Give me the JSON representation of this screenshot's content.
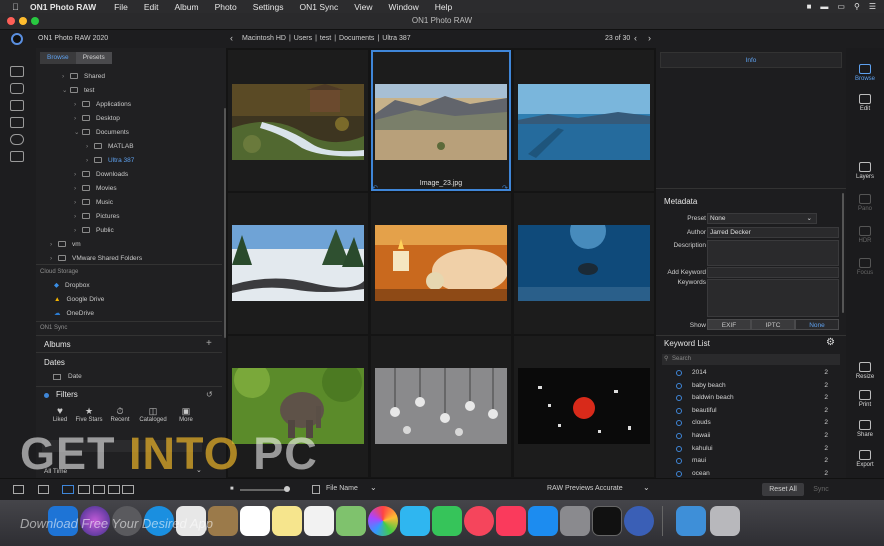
{
  "menubar": {
    "app_name": "ON1 Photo RAW",
    "items": [
      "File",
      "Edit",
      "Album",
      "Photo",
      "Settings",
      "ON1 Sync",
      "View",
      "Window",
      "Help"
    ]
  },
  "window": {
    "title": "ON1 Photo RAW"
  },
  "toolbar": {
    "app_label": "ON1 Photo RAW 2020",
    "breadcrumb": [
      "Macintosh HD",
      "Users",
      "test",
      "Documents",
      "Ultra 387"
    ],
    "position": "23 of 30"
  },
  "left_panel": {
    "tabs": [
      "Browse",
      "Presets"
    ],
    "tree": [
      {
        "label": "Shared",
        "indent": 1,
        "expanded": false
      },
      {
        "label": "test",
        "indent": 1,
        "expanded": true
      },
      {
        "label": "Applications",
        "indent": 2,
        "expanded": false
      },
      {
        "label": "Desktop",
        "indent": 2,
        "expanded": false
      },
      {
        "label": "Documents",
        "indent": 2,
        "expanded": true
      },
      {
        "label": "MATLAB",
        "indent": 3,
        "expanded": false
      },
      {
        "label": "Ultra 387",
        "indent": 3,
        "expanded": false,
        "selected": true
      },
      {
        "label": "Downloads",
        "indent": 2,
        "expanded": false
      },
      {
        "label": "Movies",
        "indent": 2,
        "expanded": false
      },
      {
        "label": "Music",
        "indent": 2,
        "expanded": false
      },
      {
        "label": "Pictures",
        "indent": 2,
        "expanded": false
      },
      {
        "label": "Public",
        "indent": 2,
        "expanded": false
      },
      {
        "label": "vm",
        "indent": 0,
        "expanded": false
      },
      {
        "label": "VMware Shared Folders",
        "indent": 0,
        "expanded": false
      }
    ],
    "cloud_storage_label": "Cloud Storage",
    "cloud": [
      "Dropbox",
      "Google Drive",
      "OneDrive"
    ],
    "sync_label": "ON1 Sync",
    "albums_label": "Albums",
    "dates_label": "Dates",
    "date_item": "Date",
    "filters_label": "Filters",
    "filter_items": [
      "Liked",
      "Five Stars",
      "Recent",
      "Cataloged",
      "More"
    ],
    "time_select": "All Time"
  },
  "grid": {
    "selected_filename": "Image_23.jpg"
  },
  "right_panel": {
    "info_tab": "Info",
    "metadata": {
      "title": "Metadata",
      "preset_label": "Preset",
      "preset_value": "None",
      "author_label": "Author",
      "author_value": "Jarred Decker",
      "description_label": "Description",
      "add_keyword_label": "Add Keyword",
      "keywords_label": "Keywords",
      "show_label": "Show",
      "show_options": [
        "EXIF",
        "IPTC",
        "None"
      ],
      "show_selected": "None"
    },
    "keyword_list": {
      "title": "Keyword List",
      "search_placeholder": "Search",
      "items": [
        {
          "name": "2014",
          "count": "2"
        },
        {
          "name": "baby beach",
          "count": "2"
        },
        {
          "name": "baldwin beach",
          "count": "2"
        },
        {
          "name": "beautiful",
          "count": "2"
        },
        {
          "name": "clouds",
          "count": "2"
        },
        {
          "name": "hawaii",
          "count": "2"
        },
        {
          "name": "kahului",
          "count": "2"
        },
        {
          "name": "maui",
          "count": "2"
        },
        {
          "name": "ocean",
          "count": "2"
        }
      ]
    }
  },
  "right_strip": {
    "items": [
      "Browse",
      "Edit",
      "Layers",
      "Pano",
      "HDR",
      "Focus",
      "Resize",
      "Print",
      "Share",
      "Export"
    ]
  },
  "bottombar": {
    "sort_label": "File Name",
    "raw_previews_label": "RAW Previews",
    "raw_previews_value": "Accurate",
    "reset_all": "Reset All",
    "sync": "Sync"
  },
  "watermark": {
    "get": "GET ",
    "into": "INTO",
    "pc": " PC",
    "sub": "Download Free Your Desired App"
  },
  "colors": {
    "accent": "#3f86d8",
    "panel": "#202022",
    "grid_bg": "#141414"
  }
}
